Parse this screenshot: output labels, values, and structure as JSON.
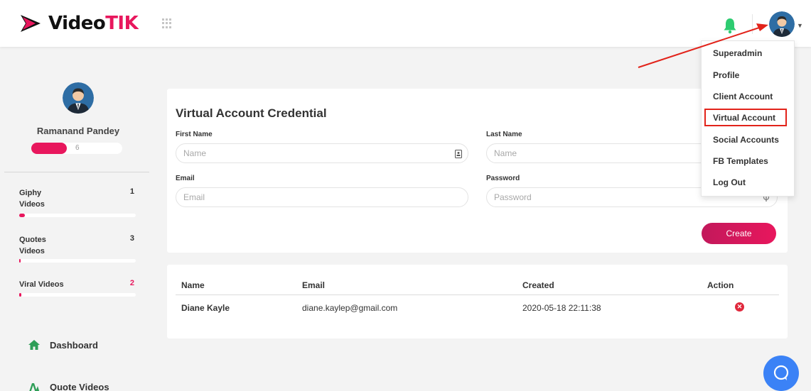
{
  "header": {
    "logo_prefix": "Video",
    "logo_suffix": "TIK"
  },
  "sidebar": {
    "user_name": "Ramanand Pandey",
    "user_count": "6",
    "stats": [
      {
        "label": "Giphy Videos",
        "count": "1",
        "fill": 0.05
      },
      {
        "label": "Quotes Videos",
        "count": "3",
        "fill": 0.01
      },
      {
        "label": "Viral Videos",
        "count": "2",
        "fill": 0.02
      }
    ],
    "nav": [
      {
        "label": "Dashboard",
        "icon": "home-icon"
      },
      {
        "label": "Quote Videos",
        "icon": "quote-videos-icon"
      }
    ]
  },
  "form": {
    "title": "Virtual Account Credential",
    "first_name_label": "First Name",
    "first_name_placeholder": "Name",
    "last_name_label": "Last Name",
    "last_name_placeholder": "Name",
    "email_label": "Email",
    "email_placeholder": "Email",
    "password_label": "Password",
    "password_placeholder": "Password",
    "create_label": "Create"
  },
  "table": {
    "columns": [
      "Name",
      "Email",
      "Created",
      "Action"
    ],
    "rows": [
      {
        "name": "Diane Kayle",
        "email": "diane.kaylep@gmail.com",
        "created": "2020-05-18 22:11:38",
        "action": "delete-icon"
      }
    ]
  },
  "dropdown": {
    "items": [
      "Superadmin",
      "Profile",
      "Client Account",
      "Virtual Account",
      "Social Accounts",
      "FB Templates",
      "Log Out"
    ],
    "highlighted": "Virtual Account"
  },
  "colors": {
    "accent": "#e8175d",
    "bell": "#2ecc71",
    "annotation": "#e2231a",
    "chat": "#3b82f6"
  }
}
